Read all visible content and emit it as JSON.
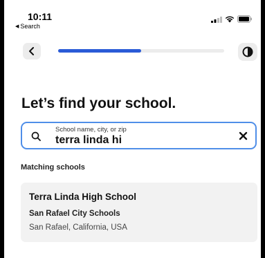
{
  "status_bar": {
    "time": "10:11",
    "back_label": "Search",
    "icons": [
      "cellular-signal-icon",
      "wifi-icon",
      "battery-icon"
    ]
  },
  "nav": {
    "back_icon": "chevron-left-icon",
    "progress": 0.5,
    "contrast_icon": "contrast-icon"
  },
  "title": "Let’s find your school.",
  "search": {
    "placeholder": "School name, city, or zip",
    "value": "terra linda hi",
    "icon": "search-icon",
    "clear_icon": "close-icon"
  },
  "results": {
    "section_label": "Matching schools",
    "items": [
      {
        "name": "Terra Linda High School",
        "district": "San Rafael City Schools",
        "location": "San Rafael, California, USA"
      }
    ]
  },
  "colors": {
    "accent": "#2a5bd7",
    "search_border": "#4f8ee8",
    "card_bg": "#f2f2f2",
    "button_bg": "#ececec"
  }
}
